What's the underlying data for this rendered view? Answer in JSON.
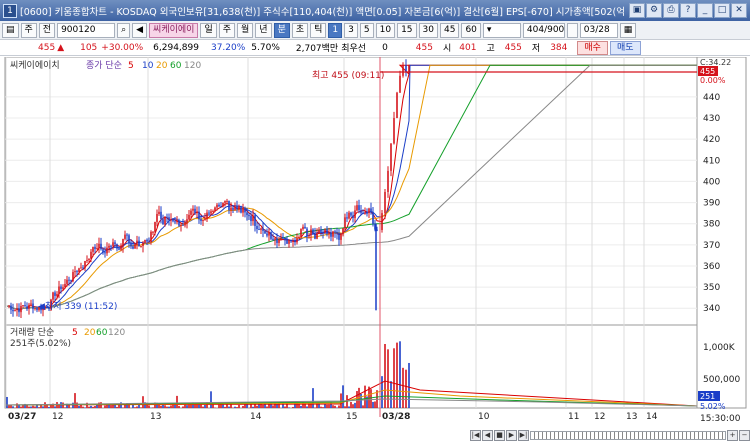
{
  "window": {
    "icon_label": "1",
    "title": "[0600] 키움종합차트 - KOSDAQ 외국인보유[31,638(천)] 주식수[110,404(천)] 액면[0.05] 자본금[6(억)] 결산[6월] EPS[-670] 시가총액[502(억"
  },
  "toolbar": {
    "mode1": "주",
    "mode2": "전",
    "code": "900120",
    "stock_name": "씨케이에이",
    "periods": [
      "일",
      "주",
      "월",
      "년",
      "분",
      "초",
      "틱"
    ],
    "active_period": "분",
    "intervals": [
      "1",
      "3",
      "5",
      "10",
      "15",
      "30",
      "45",
      "60"
    ],
    "active_interval": "1",
    "count": "404/900",
    "date": "03/28"
  },
  "info": {
    "price": "455",
    "change": "105",
    "change_pct": "+30.00%",
    "volume": "6,294,899",
    "pct1": "37.20%",
    "pct2": "5.70%",
    "amount": "2,707백만",
    "priority_label": "최우선",
    "priority_value": "0",
    "cur": "455",
    "open_label": "시",
    "open": "401",
    "high_label": "고",
    "high": "455",
    "low_label": "저",
    "low": "384",
    "buy_label": "매수",
    "sell_label": "매도"
  },
  "price_panel": {
    "stock_label": "씨케이에이치",
    "ma_label": "종가 단순",
    "ma_periods": [
      "5",
      "10",
      "20",
      "60",
      "120"
    ],
    "ma_colors": [
      "#d90000",
      "#1a3ec7",
      "#e89a00",
      "#14a02a",
      "#888888"
    ],
    "high_marker": "최고 455 (09:11)",
    "low_marker": "최저 339 (11:52)",
    "top_right_label": "C:34.22",
    "current_price_tag": "455",
    "current_pct_tag": "0.00%",
    "y_ticks": [
      "440",
      "430",
      "420",
      "410",
      "400",
      "390",
      "380",
      "370",
      "360",
      "350",
      "340"
    ]
  },
  "volume_panel": {
    "label": "거래량 단순",
    "ma_periods": [
      "5",
      "20",
      "60",
      "120"
    ],
    "sub_label": "251주(5.02%)",
    "y_ticks": [
      "1,000K",
      "500,000"
    ],
    "current_tag": "251",
    "current_pct": "5.02%"
  },
  "x_axis": {
    "labels": [
      "03/27",
      "12",
      "13",
      "14",
      "15",
      "03/28",
      "10",
      "11",
      "12",
      "13",
      "14"
    ],
    "time": "15:30:00"
  },
  "chart_data": {
    "type": "candlestick",
    "price_range": [
      333,
      457
    ],
    "open": 401,
    "high": 455,
    "low": 339,
    "close": 455,
    "ma_periods": [
      5,
      10,
      20,
      60,
      120
    ]
  }
}
